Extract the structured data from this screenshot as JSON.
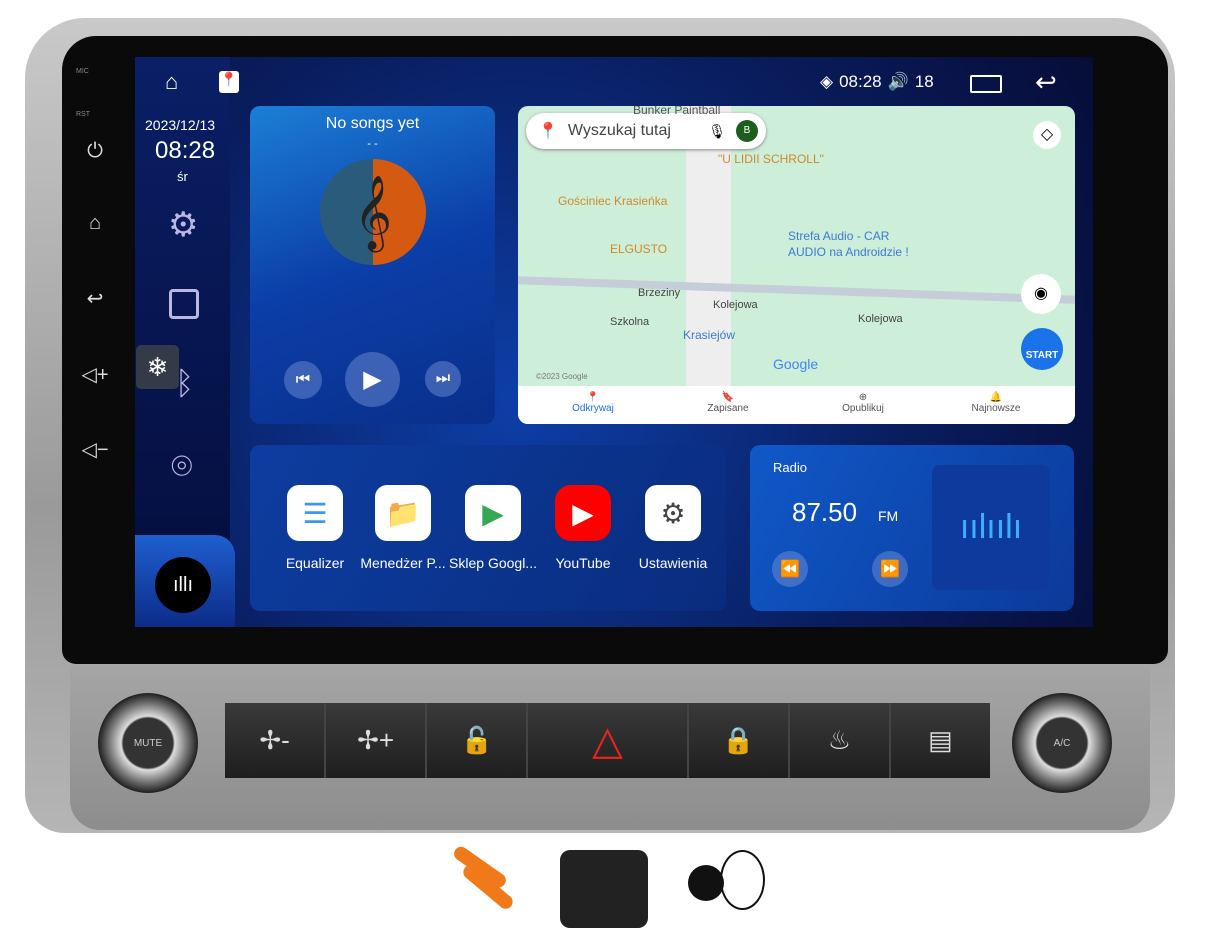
{
  "statusbar": {
    "time": "08:28",
    "volume": "18",
    "icons": [
      "home-outline-icon",
      "maps-app-icon",
      "wifi-icon",
      "volume-icon",
      "recent-apps-icon",
      "back-icon"
    ]
  },
  "hardware": {
    "mic": "MIC",
    "rst": "RST",
    "buttons": [
      "power-icon",
      "home-icon",
      "back-icon",
      "volume-up-icon",
      "volume-down-icon"
    ]
  },
  "sidebar": {
    "date": "2023/12/13",
    "time": "08:28",
    "weekday": "śr",
    "items": [
      "settings-icon",
      "radio-icon",
      "bluetooth-icon",
      "location-icon",
      "voice-icon"
    ],
    "overlay_icon": "snowflake-icon"
  },
  "music": {
    "title": "No songs yet",
    "artist": "- -"
  },
  "map": {
    "search_placeholder": "Wyszukaj tutaj",
    "avatar": "B",
    "labels": [
      "Bunker Paintball",
      "\"U LIDII SCHROLL\"",
      "Gościniec Krasieńka",
      "ELGUSTO",
      "Strefa Audio - CAR",
      "AUDIO na Androidzie !",
      "Brzeziny",
      "Kolejowa",
      "Szkolna",
      "Kolejowa",
      "Krasiejów",
      "Google",
      "©2023 Google"
    ],
    "start": "START",
    "nav": [
      "Odkrywaj",
      "Zapisane",
      "Opublikuj",
      "Najnowsze"
    ],
    "accent": "#1a73e8"
  },
  "apps": [
    {
      "label": "Equalizer"
    },
    {
      "label": "Menedżer P..."
    },
    {
      "label": "Sklep Googl..."
    },
    {
      "label": "YouTube"
    },
    {
      "label": "Ustawienia"
    }
  ],
  "radio": {
    "title": "Radio",
    "frequency": "87.50",
    "band": "FM"
  },
  "panel": {
    "left_knob": "MUTE",
    "right_knob": "A/C",
    "buttons": [
      "fan-down-icon",
      "fan-up-icon",
      "unlock-icon",
      "hazard-icon",
      "lock-icon",
      "front-defrost-icon",
      "rear-defrost-icon"
    ]
  },
  "accessories": [
    "pry-tools",
    "rear-camera",
    "gps-antenna"
  ]
}
